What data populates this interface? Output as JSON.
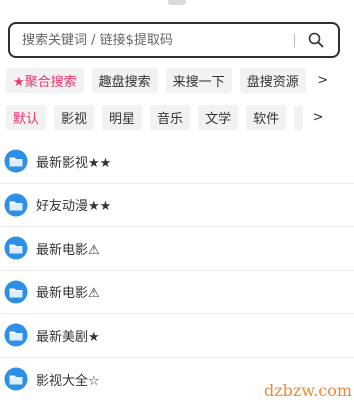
{
  "search": {
    "placeholder": "搜索关键词 / 链接$提取码",
    "icon": "search-icon"
  },
  "source_tabs": [
    {
      "label": "★聚合搜索",
      "active": true
    },
    {
      "label": "趣盘搜索",
      "active": false
    },
    {
      "label": "来搜一下",
      "active": false
    },
    {
      "label": "盘搜资源",
      "active": false
    }
  ],
  "source_more": ">",
  "category_tabs": [
    {
      "label": "默认",
      "active": true
    },
    {
      "label": "影视",
      "active": false
    },
    {
      "label": "明星",
      "active": false
    },
    {
      "label": "音乐",
      "active": false
    },
    {
      "label": "文学",
      "active": false
    },
    {
      "label": "软件",
      "active": false
    }
  ],
  "category_more": ">",
  "folders": [
    {
      "title": "最新影视★★",
      "icon": "folder-icon"
    },
    {
      "title": "好友动漫★★",
      "icon": "folder-icon"
    },
    {
      "title": "最新电影⚠",
      "icon": "folder-icon"
    },
    {
      "title": "最新电影⚠",
      "icon": "folder-icon"
    },
    {
      "title": "最新美剧★",
      "icon": "folder-icon"
    },
    {
      "title": "影视大全☆",
      "icon": "folder-icon"
    }
  ],
  "watermark": "dzbzw.com",
  "colors": {
    "accent": "#f0336b",
    "folder_blue": "#2e8fe6"
  }
}
